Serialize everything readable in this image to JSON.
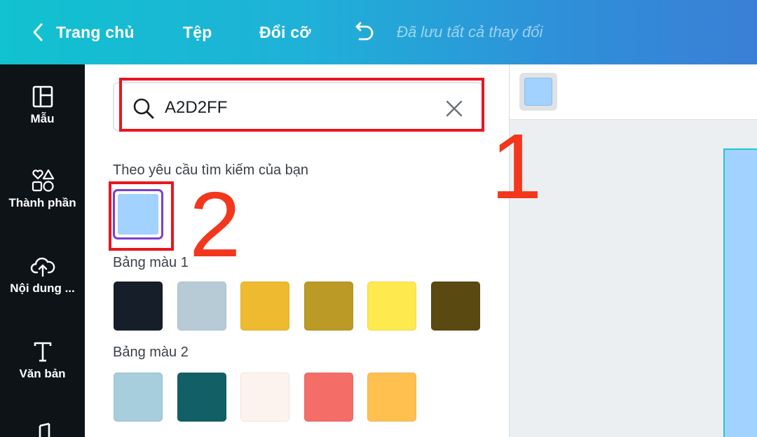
{
  "topbar": {
    "home_label": "Trang chủ",
    "file_label": "Tệp",
    "resize_label": "Đổi cỡ",
    "saved_status": "Đã lưu tất cả thay đổi"
  },
  "sidebar": {
    "items": [
      {
        "label": "Mẫu",
        "icon": "template-icon"
      },
      {
        "label": "Thành phần",
        "icon": "elements-icon"
      },
      {
        "label": "Nội dung ...",
        "icon": "cloud-upload-icon"
      },
      {
        "label": "Văn bản",
        "icon": "text-icon"
      },
      {
        "label": "",
        "icon": "music-icon"
      }
    ]
  },
  "color_panel": {
    "search_value": "A2D2FF",
    "results_title": "Theo yêu cầu tìm kiếm của bạn",
    "result_color": "#A2D2FF",
    "palette1_title": "Bảng màu 1",
    "palette1_colors": [
      "#151E29",
      "#B7CBD6",
      "#EEBA2F",
      "#BC9A26",
      "#FEE94F",
      "#5A4A12"
    ],
    "palette2_title": "Bảng màu 2",
    "palette2_colors": [
      "#A6CEDC",
      "#135F66",
      "#FDF3EE",
      "#F46E67",
      "#FFC050"
    ]
  },
  "canvas": {
    "toolbar_color": "#A2D2FF",
    "page_fill": "#A2D2FF"
  },
  "annotations": {
    "step1": "1",
    "step2": "2",
    "highlight_color": "#E8161F"
  }
}
